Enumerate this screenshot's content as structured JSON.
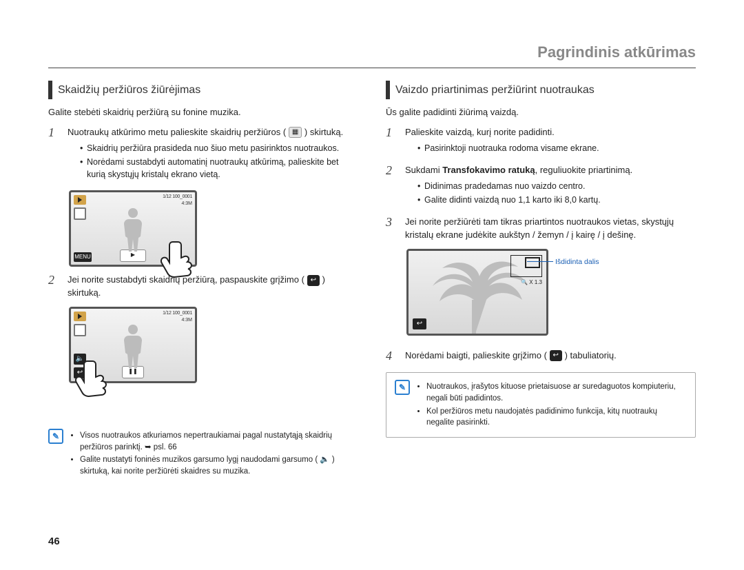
{
  "header": {
    "section_title": "Pagrindinis atkūrimas"
  },
  "page_number": "46",
  "left": {
    "heading": "Skaidžių peržiūros žiūrėjimas",
    "intro": "Galite stebėti skaidrių peržiūrą su fonine muzika.",
    "step1": {
      "num": "1",
      "text_a": "Nuotraukų atkūrimo metu palieskite skaidrių peržiūros (",
      "text_b": ") skirtuką.",
      "icon_name": "slideshow-icon",
      "bullets": [
        "Skaidrių peržiūra prasideda nuo šiuo metu pasirinktos nuotraukos.",
        "Norėdami sustabdyti automatinį nuotraukų atkūrimą, palieskite bet kurią skystųjų kristalų ekrano vietą."
      ]
    },
    "lcd1": {
      "counter": "1/12    100_0001",
      "mode": "4:3M",
      "menu_label": "MENU",
      "slideshow_label": "▶"
    },
    "step2": {
      "num": "2",
      "text_a": "Jei norite sustabdyti skaidrių peržiūrą, paspauskite grįžimo (",
      "text_b": ") skirtuką.",
      "icon_name": "back-icon"
    },
    "lcd2": {
      "counter": "1/12    100_0001",
      "mode": "4:3M"
    },
    "note": {
      "items": [
        "Visos nuotraukos atkuriamos nepertraukiamai pagal nustatytąją skaidrių peržiūros parinktį. ➥ psl. 66",
        "Galite nustatyti foninės muzikos garsumo lygį naudodami garsumo ( 🔈 ) skirtuką, kai norite peržiūrėti skaidres su muzika."
      ]
    }
  },
  "right": {
    "heading": "Vaizdo priartinimas peržiūrint nuotraukas",
    "intro": "Ūs galite padidinti žiūrimą vaizdą.",
    "step1": {
      "num": "1",
      "text": "Palieskite vaizdą, kurį norite padidinti.",
      "bullets": [
        "Pasirinktoji nuotrauka rodoma visame ekrane."
      ]
    },
    "step2": {
      "num": "2",
      "text_a": "Sukdami ",
      "bold": "Transfokavimo ratuką",
      "text_b": ", reguliuokite priartinimą.",
      "bullets": [
        "Didinimas pradedamas nuo vaizdo centro.",
        "Galite didinti vaizdą nuo 1,1 karto iki 8,0 kartų."
      ]
    },
    "step3": {
      "num": "3",
      "text": "Jei norite peržiūrėti tam tikras priartintos nuotraukos vietas, skystųjų kristalų ekrane judėkite aukštyn / žemyn / į kairę / į dešinę."
    },
    "zoom_screen": {
      "zoom_label": "🔍 X 1.3",
      "callout": "Išdidinta dalis"
    },
    "step4": {
      "num": "4",
      "text_a": "Norėdami baigti, palieskite grįžimo (",
      "text_b": ") tabuliatorių.",
      "icon_name": "back-icon"
    },
    "note": {
      "items": [
        "Nuotraukos, įrašytos kituose prietaisuose ar suredaguotos kompiuteriu, negali būti padidintos.",
        "Kol peržiūros metu naudojatės padidinimo funkcija, kitų nuotraukų negalite pasirinkti."
      ]
    }
  }
}
